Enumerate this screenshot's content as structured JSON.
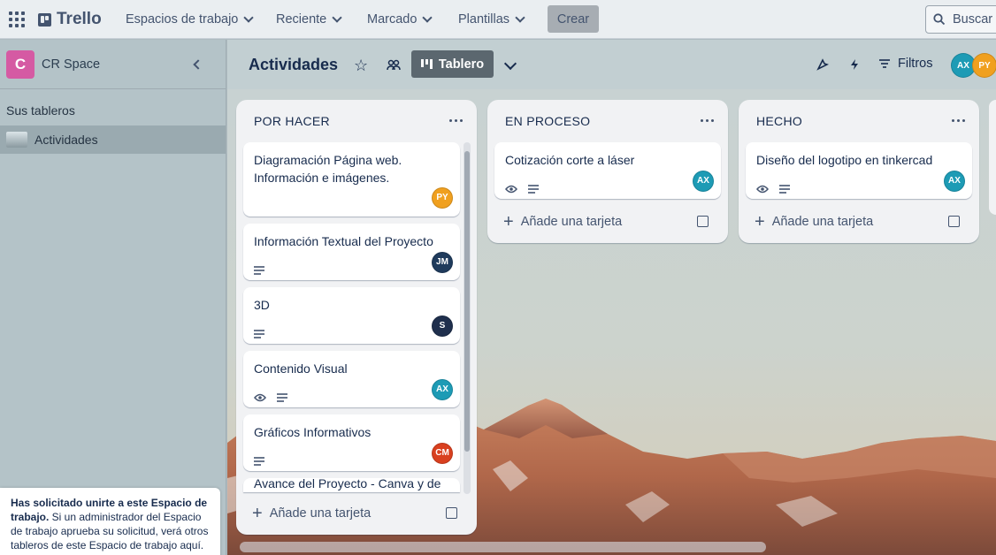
{
  "topbar": {
    "logo": "Trello",
    "nav": [
      {
        "label": "Espacios de trabajo"
      },
      {
        "label": "Reciente"
      },
      {
        "label": "Marcado"
      },
      {
        "label": "Plantillas"
      }
    ],
    "create_label": "Crear",
    "search_placeholder": "Buscar"
  },
  "sidebar": {
    "workspace_initial": "C",
    "workspace_name": "CR Space",
    "boards_title": "Sus tableros",
    "boards": [
      {
        "label": "Actividades"
      }
    ],
    "join_notice": {
      "bold": "Has solicitado unirte a este Espacio de trabajo.",
      "text": " Si un administrador del Espacio de trabajo aprueba su solicitud, verá otros tableros de este Espacio de trabajo aquí."
    }
  },
  "boardbar": {
    "title": "Actividades",
    "view_label": "Tablero",
    "filters_label": "Filtros",
    "members": [
      {
        "initials": "AX",
        "color": "#1d9bb5"
      },
      {
        "initials": "PY",
        "color": "#f0a01f"
      }
    ]
  },
  "lists": [
    {
      "title": "POR HACER",
      "add_label": "Añade una tarjeta",
      "cards": [
        {
          "title": "Diagramación Página web. Información e imágenes.",
          "member": "PY",
          "member_color": "#f0a01f",
          "watch": false,
          "desc": false
        },
        {
          "title": "Información Textual del Proyecto",
          "member": "JM",
          "member_color": "#1f3b5c",
          "watch": false,
          "desc": true
        },
        {
          "title": "3D",
          "member": "S",
          "member_color": "#1f2f4d",
          "watch": false,
          "desc": true
        },
        {
          "title": "Contenido Visual",
          "member": "AX",
          "member_color": "#1d9bb5",
          "watch": true,
          "desc": true
        },
        {
          "title": "Gráficos Informativos",
          "member": "CM",
          "member_color": "#d9401f",
          "watch": false,
          "desc": true
        },
        {
          "title": "Avance del Proyecto - Canva y de",
          "member": "",
          "member_color": "",
          "watch": false,
          "desc": false
        }
      ]
    },
    {
      "title": "EN PROCESO",
      "add_label": "Añade una tarjeta",
      "cards": [
        {
          "title": "Cotización corte a láser",
          "member": "AX",
          "member_color": "#1d9bb5",
          "watch": true,
          "desc": true
        }
      ]
    },
    {
      "title": "HECHO",
      "add_label": "Añade una tarjeta",
      "cards": [
        {
          "title": "Diseño del logotipo en tinkercad",
          "member": "AX",
          "member_color": "#1d9bb5",
          "watch": true,
          "desc": true
        }
      ]
    }
  ]
}
